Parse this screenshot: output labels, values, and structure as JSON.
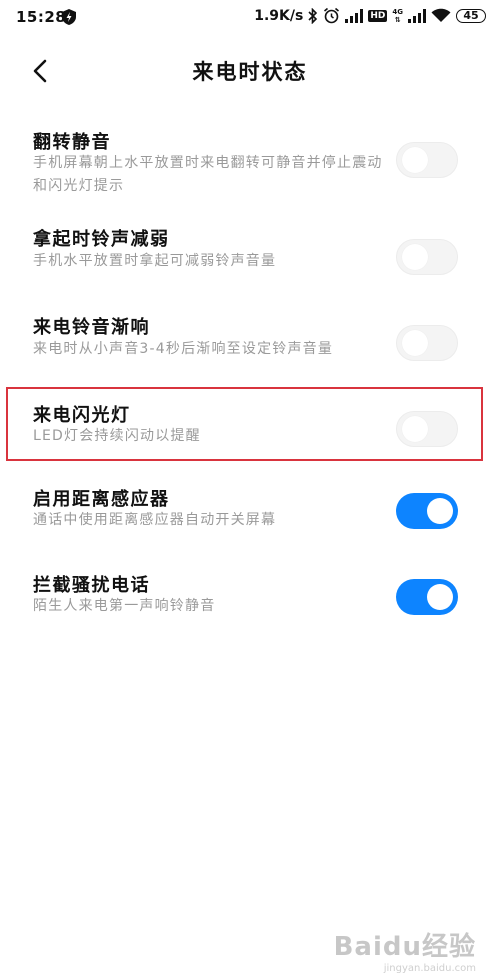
{
  "status_bar": {
    "time": "15:28",
    "net_speed": "1.9K/s",
    "network_type": "4G",
    "hd_badge": "HD",
    "battery": "45"
  },
  "header": {
    "title": "来电时状态"
  },
  "settings": [
    {
      "title": "翻转静音",
      "desc": "手机屏幕朝上水平放置时来电翻转可静音并停止震动和闪光灯提示",
      "enabled": false
    },
    {
      "title": "拿起时铃声减弱",
      "desc": "手机水平放置时拿起可减弱铃声音量",
      "enabled": false
    },
    {
      "title": "来电铃音渐响",
      "desc": "来电时从小声音3-4秒后渐响至设定铃声音量",
      "enabled": false
    },
    {
      "title": "来电闪光灯",
      "desc": "LED灯会持续闪动以提醒",
      "enabled": false
    },
    {
      "title": "启用距离感应器",
      "desc": "通话中使用距离感应器自动开关屏幕",
      "enabled": true
    },
    {
      "title": "拦截骚扰电话",
      "desc": "陌生人来电第一声响铃静音",
      "enabled": true
    }
  ],
  "watermark": {
    "logo": "Baidu经验",
    "url": "jingyan.baidu.com"
  },
  "colors": {
    "toggle_on": "#0d84ff",
    "toggle_off": "#f4f4f4",
    "highlight": "#d9343e",
    "desc_text": "#9a9a9a"
  }
}
